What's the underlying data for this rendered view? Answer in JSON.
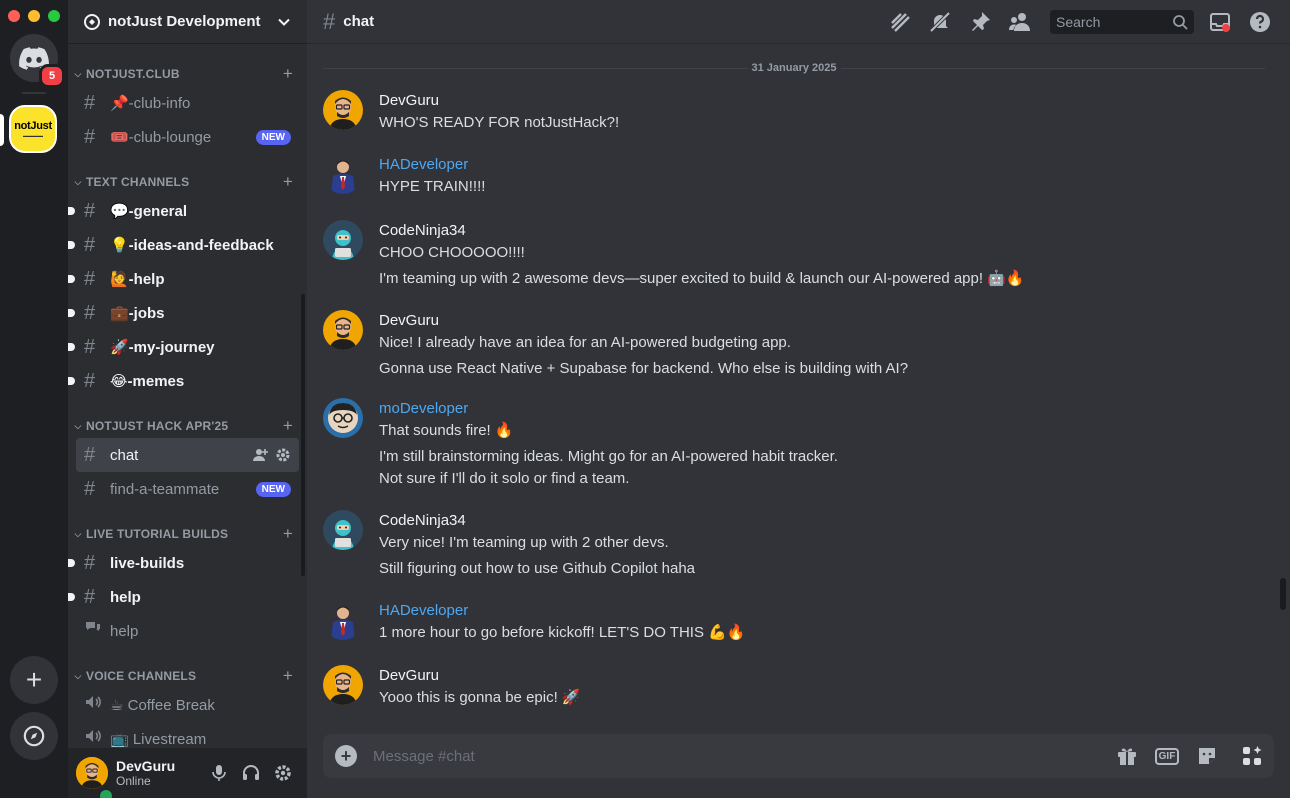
{
  "rail": {
    "home_badge": "5",
    "server_logo_text": "notJust",
    "add_label": "+"
  },
  "sidebar": {
    "server_name": "notJust Development",
    "categories": [
      {
        "label": "notjust.club",
        "channels": [
          {
            "label": "📌-club-info"
          },
          {
            "label": "🎟️-club-lounge",
            "badge": "NEW"
          }
        ]
      },
      {
        "label": "Text Channels",
        "channels": [
          {
            "label": "💬-general"
          },
          {
            "label": "💡-ideas-and-feedback"
          },
          {
            "label": "🙋-help"
          },
          {
            "label": "💼-jobs"
          },
          {
            "label": "🚀-my-journey"
          },
          {
            "label": "😂-memes"
          }
        ]
      },
      {
        "label": "notJust Hack Apr'25",
        "channels": [
          {
            "label": "chat"
          },
          {
            "label": "find-a-teammate",
            "badge": "NEW"
          }
        ]
      },
      {
        "label": "Live Tutorial Builds",
        "channels": [
          {
            "label": "live-builds"
          },
          {
            "label": "help"
          },
          {
            "label": "help"
          }
        ]
      },
      {
        "label": "Voice Channels",
        "channels": [
          {
            "label": "☕ Coffee Break"
          },
          {
            "label": "📺 Livestream"
          }
        ]
      }
    ]
  },
  "user": {
    "name": "DevGuru",
    "status": "Online"
  },
  "topbar": {
    "channel_name": "chat",
    "search_placeholder": "Search"
  },
  "messages": {
    "date": "31 January 2025",
    "items": [
      {
        "author": "DevGuru",
        "lines": [
          "WHO'S READY FOR notJustHack?!"
        ]
      },
      {
        "author": "HADeveloper",
        "lines": [
          "HYPE TRAIN!!!!"
        ]
      },
      {
        "author": "CodeNinja34",
        "lines": [
          "CHOO CHOOOOO!!!!",
          "I'm teaming up with 2 awesome devs—super excited to build & launch our AI-powered app! 🤖🔥"
        ]
      },
      {
        "author": "DevGuru",
        "lines": [
          "Nice! I already have an idea for an AI-powered budgeting app.",
          "Gonna use React Native + Supabase for backend. Who else is building with AI?"
        ]
      },
      {
        "author": "moDeveloper",
        "lines": [
          "That sounds fire! 🔥",
          "I'm still brainstorming ideas. Might go for an AI-powered habit tracker.",
          "Not sure if I'll do it solo or find a team."
        ]
      },
      {
        "author": "CodeNinja34",
        "lines": [
          "Very nice! I'm teaming up with 2 other devs.",
          "Still figuring out how to use Github Copilot haha"
        ]
      },
      {
        "author": "HADeveloper",
        "lines": [
          "1 more hour to go before kickoff! LET'S DO THIS 💪🔥"
        ]
      },
      {
        "author": "DevGuru",
        "lines": [
          "Yooo this is gonna be epic! 🚀"
        ]
      }
    ]
  },
  "composer": {
    "placeholder": "Message #chat",
    "gif_label": "GIF"
  },
  "colors": {
    "accent": "#5865f2",
    "online": "#23a55a",
    "mention_badge": "#f23f43",
    "author_blue": "#4ea8f1"
  }
}
